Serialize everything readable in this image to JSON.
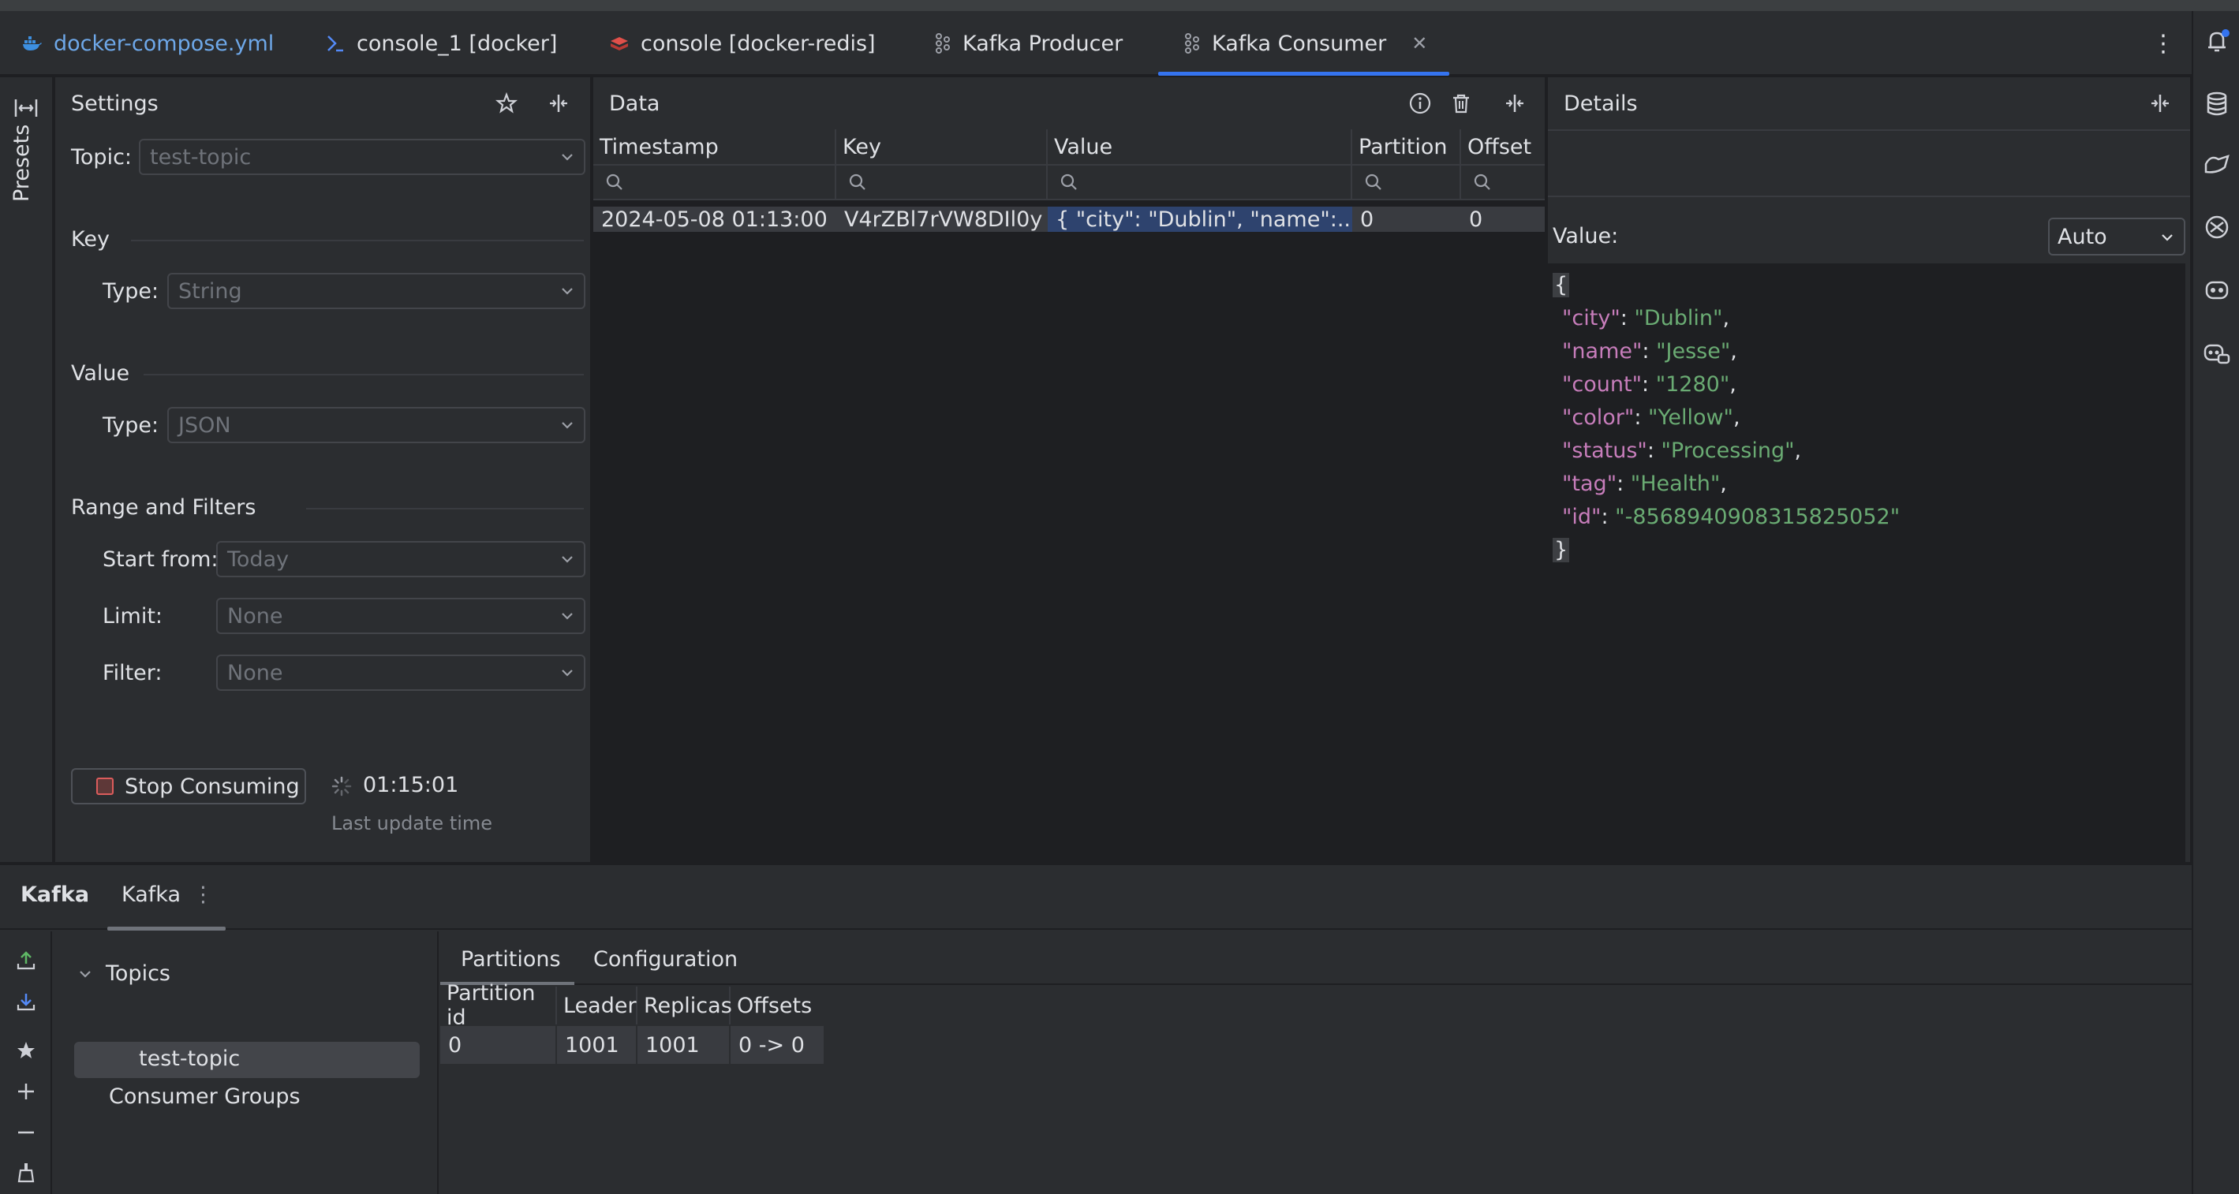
{
  "tabs": [
    {
      "label": "docker-compose.yml",
      "icon": "docker-icon",
      "color": "#6ea8e9"
    },
    {
      "label": "console_1 [docker]",
      "icon": "console-icon",
      "color": "#dfe1e5"
    },
    {
      "label": "console [docker-redis]",
      "icon": "redis-icon",
      "color": "#dfe1e5"
    },
    {
      "label": "Kafka Producer",
      "icon": "kafka-icon",
      "color": "#dfe1e5"
    },
    {
      "label": "Kafka Consumer",
      "icon": "kafka-icon",
      "color": "#dfe1e5",
      "active": true
    }
  ],
  "left_strip": {
    "presets_label": "Presets"
  },
  "settings": {
    "title": "Settings",
    "topic_label": "Topic:",
    "topic_value": "test-topic",
    "key_section": "Key",
    "key_type_label": "Type:",
    "key_type_value": "String",
    "value_section": "Value",
    "value_type_label": "Type:",
    "value_type_value": "JSON",
    "range_section": "Range and Filters",
    "start_from_label": "Start from:",
    "start_from_value": "Today",
    "limit_label": "Limit:",
    "limit_value": "None",
    "filter_label": "Filter:",
    "filter_value": "None",
    "stop_button": "Stop Consuming",
    "update_time": "01:15:01",
    "last_update_label": "Last update time"
  },
  "data": {
    "title": "Data",
    "columns": [
      "Timestamp",
      "Key",
      "Value",
      "Partition",
      "Offset"
    ],
    "rows": [
      {
        "timestamp": "2024-05-08 01:13:00",
        "key": "V4rZBl7rVW8DIl0y",
        "value": "{   \"city\": \"Dublin\",   \"name\":...",
        "partition": "0",
        "offset": "0"
      }
    ]
  },
  "details": {
    "title": "Details",
    "value_label": "Value:",
    "format_value": "Auto",
    "json_open": "{",
    "json_close": "}",
    "fields": [
      {
        "key": "\"city\"",
        "value": "\"Dublin\""
      },
      {
        "key": "\"name\"",
        "value": "\"Jesse\""
      },
      {
        "key": "\"count\"",
        "value": "\"1280\""
      },
      {
        "key": "\"color\"",
        "value": "\"Yellow\""
      },
      {
        "key": "\"status\"",
        "value": "\"Processing\""
      },
      {
        "key": "\"tag\"",
        "value": "\"Health\""
      },
      {
        "key": "\"id\"",
        "value": "\"-8568940908315825052\""
      }
    ]
  },
  "bottom": {
    "title": "Kafka",
    "tab": "Kafka",
    "tree": {
      "topics": "Topics",
      "topic_item": "test-topic",
      "consumer_groups": "Consumer Groups"
    },
    "tabs": [
      "Partitions",
      "Configuration"
    ],
    "partition_columns": [
      "Partition id",
      "Leader",
      "Replicas",
      "Offsets"
    ],
    "partition_rows": [
      {
        "id": "0",
        "leader": "1001",
        "replicas": "1001",
        "offsets": "0 -> 0"
      }
    ]
  },
  "colors": {
    "accent": "#3574f0",
    "json_key": "#c77dbb",
    "json_string": "#6aab73",
    "selection": "#2e436e"
  }
}
